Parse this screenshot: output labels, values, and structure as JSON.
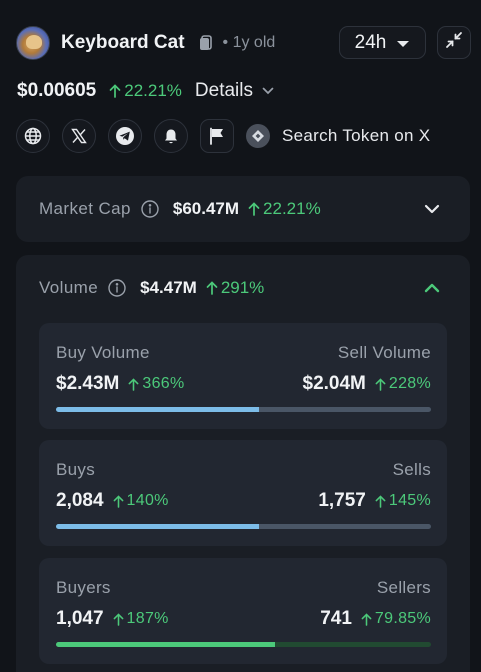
{
  "token": {
    "name": "Keyboard Cat",
    "age": "• 1y old",
    "timeframe": "24h",
    "price": "$0.00605",
    "price_change": "22.21%",
    "details_label": "Details",
    "search_label": "Search Token on X"
  },
  "market_cap": {
    "label": "Market Cap",
    "value": "$60.47M",
    "change": "22.21%"
  },
  "volume": {
    "label": "Volume",
    "value": "$4.47M",
    "change": "291%",
    "panels": [
      {
        "left_label": "Buy Volume",
        "right_label": "Sell Volume",
        "left_value": "$2.43M",
        "left_change": "366%",
        "right_value": "$2.04M",
        "right_change": "228%",
        "ratio": 0.54,
        "fill_color": "#7cbce8",
        "rest_color": "#4a5666"
      },
      {
        "left_label": "Buys",
        "right_label": "Sells",
        "left_value": "2,084",
        "left_change": "140%",
        "right_value": "1,757",
        "right_change": "145%",
        "ratio": 0.54,
        "fill_color": "#7cbce8",
        "rest_color": "#4a5666"
      },
      {
        "left_label": "Buyers",
        "right_label": "Sellers",
        "left_value": "1,047",
        "left_change": "187%",
        "right_value": "741",
        "right_change": "79.85%",
        "ratio": 0.585,
        "fill_color": "#4cc97a",
        "rest_color": "#214a31"
      }
    ]
  },
  "colors": {
    "positive": "#4cc97a",
    "accent_up_chevron": "#4cc97a"
  }
}
